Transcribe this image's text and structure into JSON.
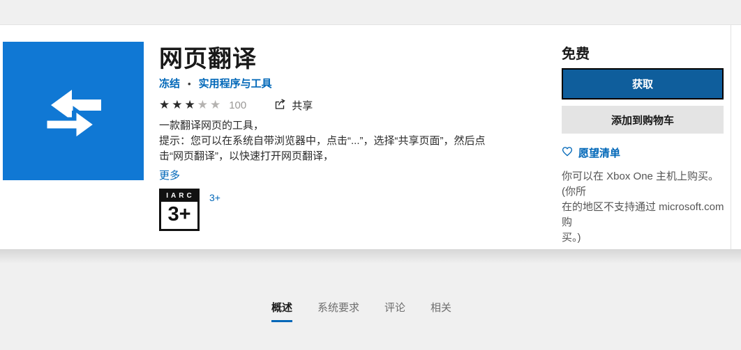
{
  "app": {
    "title": "网页翻译",
    "publisher": "冻结",
    "separator": "•",
    "category": "实用程序与工具",
    "rating": {
      "stars_filled": "★★★",
      "stars_empty": "★★",
      "count": "100"
    },
    "share_label": "共享",
    "description": "一款翻译网页的工具，\n提示：您可以在系统自带浏览器中，点击“...”，选择“共享页面”，然后点\n击“网页翻译”，以快速打开网页翻译，",
    "more_label": "更多",
    "age_rating": {
      "org": "IARC",
      "value": "3+",
      "link_label": "3+"
    }
  },
  "purchase": {
    "price": "免费",
    "get_button": "获取",
    "add_to_cart_button": "添加到购物车",
    "wishlist_label": "愿望清单",
    "availability_note": "你可以在 Xbox One 主机上购买。(你所\n在的地区不支持通过 microsoft.com 购\n买。)"
  },
  "tabs": [
    {
      "label": "概述",
      "active": true
    },
    {
      "label": "系统要求",
      "active": false
    },
    {
      "label": "评论",
      "active": false
    },
    {
      "label": "相关",
      "active": false
    }
  ],
  "colors": {
    "accent_link": "#0067b8",
    "tile_background": "#1078d4",
    "get_button_background": "#0f5e9c",
    "page_band": "#f0f0f0"
  }
}
